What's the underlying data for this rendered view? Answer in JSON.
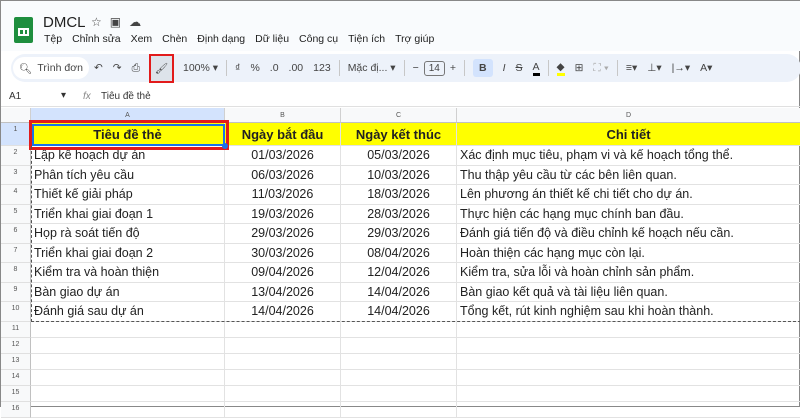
{
  "doc": {
    "title": "DMCL",
    "icons": [
      "star-icon",
      "move-folder-icon",
      "cloud-status-icon"
    ]
  },
  "menu": [
    "Tệp",
    "Chỉnh sửa",
    "Xem",
    "Chèn",
    "Định dạng",
    "Dữ liệu",
    "Công cụ",
    "Tiện ích",
    "Trợ giúp"
  ],
  "toolbar": {
    "search": "Trình đơn",
    "zoom": "100%",
    "currency": "₫",
    "percent": "%",
    "dec_less": ".0",
    "dec_more": ".00",
    "number_format": "123",
    "font": "Mặc đị...",
    "font_size": "14",
    "minus": "−",
    "plus": "+",
    "bold": "B",
    "italic": "I",
    "strike": "S",
    "text_color": "A",
    "text_color_hex": "#000000",
    "fill_color_hex": "#ffff00"
  },
  "formula_bar": {
    "cell_ref": "A1",
    "fx": "fx",
    "value": "Tiêu đề thẻ"
  },
  "columns": [
    "A",
    "B",
    "C",
    "D"
  ],
  "headers": [
    "Tiêu đề thẻ",
    "Ngày bắt đầu",
    "Ngày kết thúc",
    "Chi tiết"
  ],
  "rows": [
    [
      "Lập kế hoạch dự án",
      "01/03/2026",
      "05/03/2026",
      "Xác định mục tiêu, phạm vi và kế hoạch tổng thể."
    ],
    [
      "Phân tích yêu cầu",
      "06/03/2026",
      "10/03/2026",
      "Thu thập yêu cầu từ các bên liên quan."
    ],
    [
      "Thiết kế giải pháp",
      "11/03/2026",
      "18/03/2026",
      "Lên phương án thiết kế chi tiết cho dự án."
    ],
    [
      "Triển khai giai đoạn 1",
      "19/03/2026",
      "28/03/2026",
      "Thực hiện các hạng mục chính ban đầu."
    ],
    [
      "Họp rà soát tiến độ",
      "29/03/2026",
      "29/03/2026",
      "Đánh giá tiến độ và điều chỉnh kế hoạch nếu cần."
    ],
    [
      "Triển khai giai đoạn 2",
      "30/03/2026",
      "08/04/2026",
      "Hoàn thiện các hạng mục còn lại."
    ],
    [
      "Kiểm tra và hoàn thiện",
      "09/04/2026",
      "12/04/2026",
      "Kiểm tra, sửa lỗi và hoàn chỉnh sản phẩm."
    ],
    [
      "Bàn giao dự án",
      "13/04/2026",
      "14/04/2026",
      "Bàn giao kết quả và tài liệu liên quan."
    ],
    [
      "Đánh giá sau dự án",
      "14/04/2026",
      "14/04/2026",
      "Tổng kết, rút kinh nghiệm sau khi hoàn thành."
    ]
  ],
  "row_numbers": [
    "1",
    "2",
    "3",
    "4",
    "5",
    "6",
    "7",
    "8",
    "9",
    "10",
    "11",
    "12",
    "13",
    "14",
    "15",
    "16"
  ]
}
